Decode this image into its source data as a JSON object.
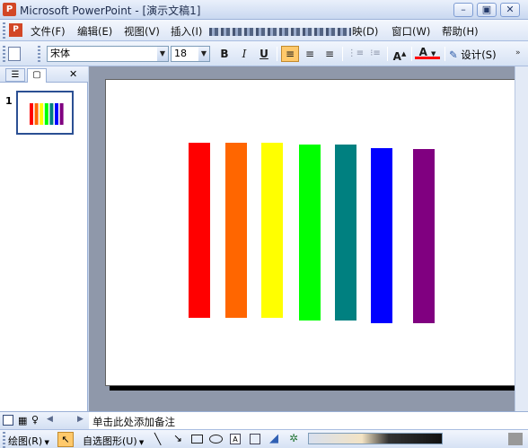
{
  "window": {
    "title": "Microsoft PowerPoint - [演示文稿1]",
    "minimize": "–",
    "restore": "▣",
    "close": "✕"
  },
  "menu": {
    "items": [
      "文件(F)",
      "编辑(E)",
      "视图(V)",
      "插入(I)",
      "映(D)",
      "窗口(W)",
      "帮助(H)"
    ]
  },
  "format_toolbar": {
    "font_name": "宋体",
    "font_size": "18",
    "bold": "B",
    "italic": "I",
    "underline": "U",
    "align_left": "≡",
    "align_center": "≡",
    "align_right": "≡",
    "numbering": "⋮≡",
    "bullets": "⁝≡",
    "grow_font": "A",
    "font_color": "A",
    "design": "设计(S)"
  },
  "slides_panel": {
    "tab_outline": "☰",
    "tab_slides": "▢",
    "close": "✕",
    "slide_number": "1"
  },
  "slide": {
    "bars": [
      {
        "color": "#ff0000"
      },
      {
        "color": "#ff6600"
      },
      {
        "color": "#ffff00"
      },
      {
        "color": "#00ff00"
      },
      {
        "color": "#008080"
      },
      {
        "color": "#0000ff"
      },
      {
        "color": "#800080"
      }
    ]
  },
  "notes": {
    "placeholder": "单击此处添加备注"
  },
  "drawing_toolbar": {
    "draw_menu": "绘图(R)",
    "autoshapes": "自选图形(U)"
  }
}
